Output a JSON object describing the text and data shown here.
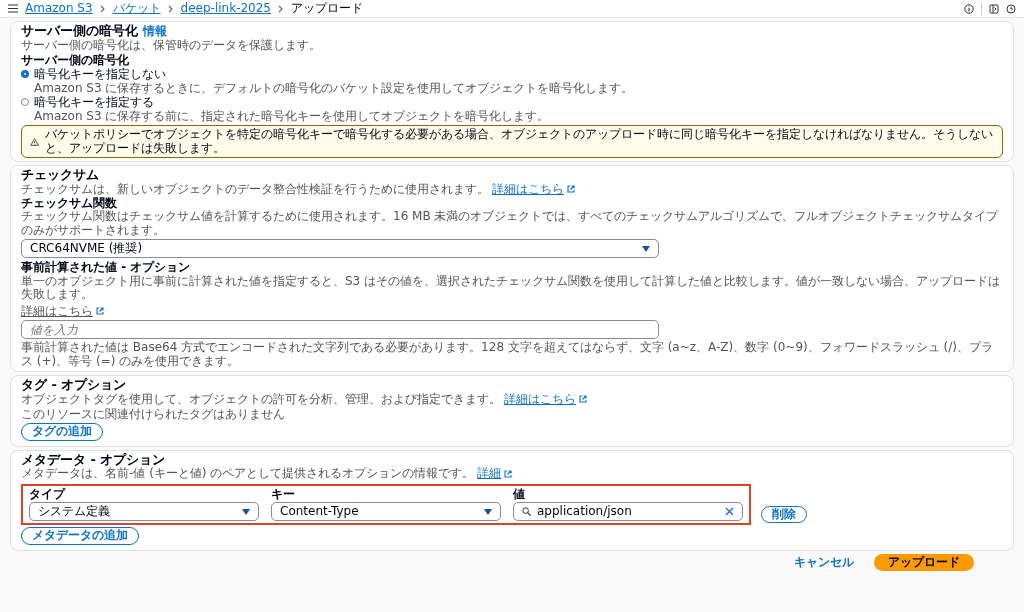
{
  "breadcrumb": [
    {
      "label": "Amazon S3",
      "link": true
    },
    {
      "label": "バケット",
      "link": true
    },
    {
      "label": "deep-link-2025",
      "link": true
    },
    {
      "label": "アップロード",
      "link": false
    }
  ],
  "encryption": {
    "title": "サーバー側の暗号化",
    "info": "情報",
    "description": "サーバー側の暗号化は、保管時のデータを保護します。",
    "field_label": "サーバー側の暗号化",
    "options": [
      {
        "label": "暗号化キーを指定しない",
        "description": "Amazon S3 に保存するときに、デフォルトの暗号化のバケット設定を使用してオブジェクトを暗号化します。",
        "selected": true
      },
      {
        "label": "暗号化キーを指定する",
        "description": "Amazon S3 に保存する前に、指定された暗号化キーを使用してオブジェクトを暗号化します。",
        "selected": false
      }
    ],
    "warning": "バケットポリシーでオブジェクトを特定の暗号化キーで暗号化する必要がある場合、オブジェクトのアップロード時に同じ暗号化キーを指定しなければなりません。そうしないと、アップロードは失敗します。"
  },
  "checksum": {
    "title": "チェックサム",
    "description": "チェックサムは、新しいオブジェクトのデータ整合性検証を行うために使用されます。",
    "link": "詳細はこちら",
    "function_field": {
      "label": "チェックサム関数",
      "help": "チェックサム関数はチェックサム値を計算するために使用されます。16 MB 未満のオブジェクトでは、すべてのチェックサムアルゴリズムで、フルオブジェクトチェックサムタイプのみがサポートされます。",
      "value": "CRC64NVME (推奨)"
    },
    "precomputed": {
      "label": "事前計算された値 - オプション",
      "help": "単一のオブジェクト用に事前に計算された値を指定すると、S3 はその値を、選択されたチェックサム関数を使用して計算した値と比較します。値が一致しない場合、アップロードは失敗します。",
      "link": "詳細はこちら",
      "placeholder": "値を入力",
      "note": "事前計算された値は Base64 方式でエンコードされた文字列である必要があります。128 文字を超えてはならず、文字 (a~z、A-Z)、数字 (0~9)、フォワードスラッシュ (/)、プラス (+)、等号 (=) のみを使用できます。"
    }
  },
  "tags": {
    "title": "タグ - オプション",
    "description": "オブジェクトタグを使用して、オブジェクトの許可を分析、管理、および指定できます。",
    "link": "詳細はこちら",
    "empty_text": "このリソースに関連付けられたタグはありません",
    "add_button": "タグの追加"
  },
  "metadata": {
    "title": "メタデータ - オプション",
    "description": "メタデータは、名前-値 (キーと値) のペアとして提供されるオプションの情報です。",
    "link": "詳細",
    "highlighted": true,
    "columns": [
      "タイプ",
      "キー",
      "値"
    ],
    "rows": [
      {
        "type": "システム定義",
        "key": "Content-Type",
        "value": "application/json",
        "remove": "削除"
      }
    ],
    "add_button": "メタデータの追加"
  },
  "footer": {
    "cancel": "キャンセル",
    "submit": "アップロード"
  }
}
